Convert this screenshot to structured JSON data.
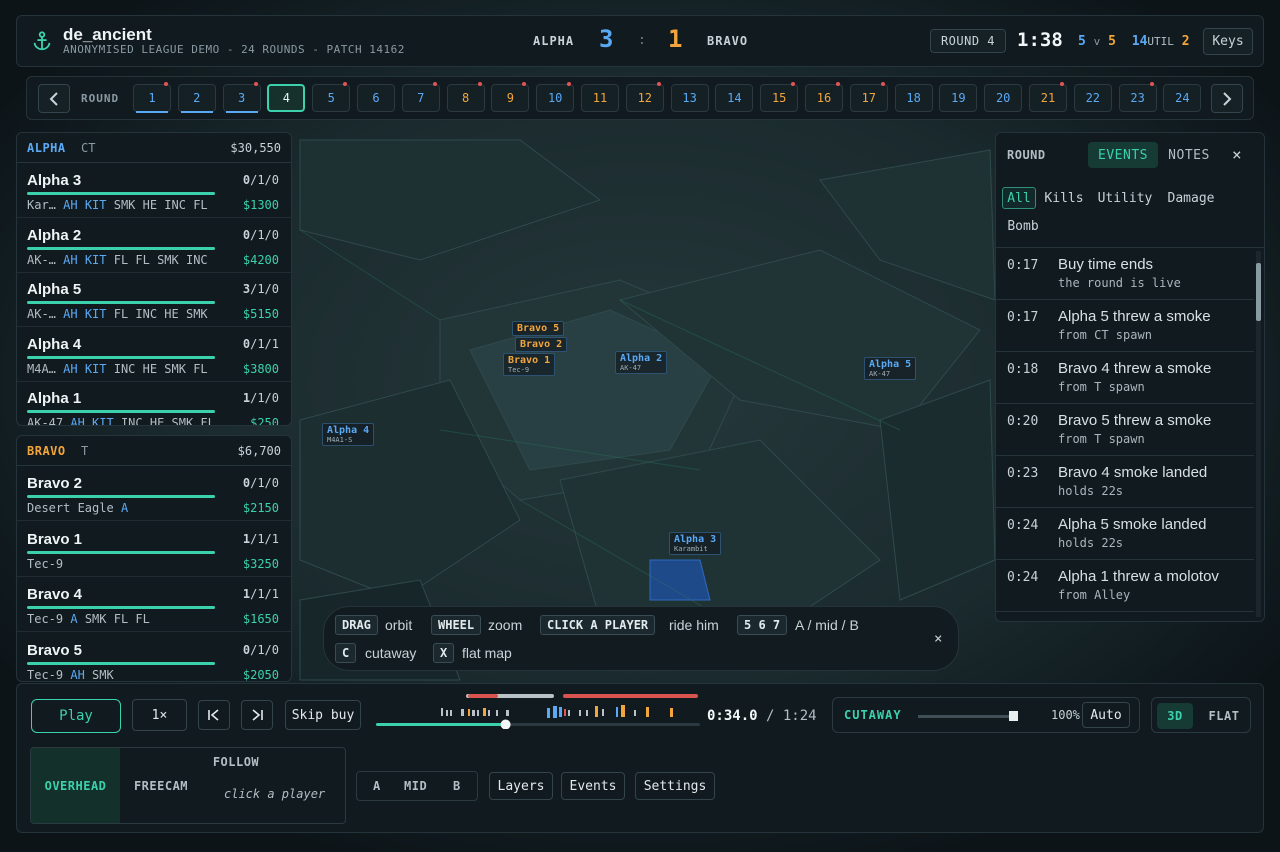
{
  "header": {
    "map_name": "de_ancient",
    "subtitle": "ANONYMISED LEAGUE DEMO - 24 ROUNDS - PATCH 14162",
    "team_a": "ALPHA",
    "score_a": "3",
    "score_sep": ":",
    "score_b": "1",
    "team_b": "BRAVO",
    "round_label": "ROUND 4",
    "clock": "1:38",
    "alive_a": "5",
    "alive_v": "v",
    "alive_b": "5",
    "util_count": "14",
    "util_label": "UTIL",
    "util_b": "2",
    "keys_label": "Keys",
    "icon": "anchor-icon"
  },
  "round_strip": {
    "label": "ROUND",
    "rounds": [
      {
        "n": "1",
        "side": "a",
        "dot": true,
        "played": true
      },
      {
        "n": "2",
        "side": "a",
        "dot": false,
        "played": true
      },
      {
        "n": "3",
        "side": "a",
        "dot": true,
        "played": true
      },
      {
        "n": "4",
        "side": "a",
        "dot": false,
        "current": true
      },
      {
        "n": "5",
        "side": "a",
        "dot": true
      },
      {
        "n": "6",
        "side": "a",
        "dot": false
      },
      {
        "n": "7",
        "side": "a",
        "dot": true
      },
      {
        "n": "8",
        "side": "b",
        "dot": true
      },
      {
        "n": "9",
        "side": "b",
        "dot": true
      },
      {
        "n": "10",
        "side": "a",
        "dot": true
      },
      {
        "n": "11",
        "side": "b",
        "dot": false
      },
      {
        "n": "12",
        "side": "b",
        "dot": true
      },
      {
        "n": "13",
        "side": "a",
        "dot": false
      },
      {
        "n": "14",
        "side": "a",
        "dot": false
      },
      {
        "n": "15",
        "side": "b",
        "dot": true
      },
      {
        "n": "16",
        "side": "b",
        "dot": true
      },
      {
        "n": "17",
        "side": "b",
        "dot": true
      },
      {
        "n": "18",
        "side": "a",
        "dot": false
      },
      {
        "n": "19",
        "side": "a",
        "dot": false
      },
      {
        "n": "20",
        "side": "a",
        "dot": false
      },
      {
        "n": "21",
        "side": "b",
        "dot": true
      },
      {
        "n": "22",
        "side": "a",
        "dot": false
      },
      {
        "n": "23",
        "side": "a",
        "dot": true
      },
      {
        "n": "24",
        "side": "a",
        "dot": false
      }
    ]
  },
  "alpha_panel": {
    "name": "ALPHA",
    "side": "CT",
    "money": "$30,550",
    "players": [
      {
        "name": "Alpha 3",
        "k": "0",
        "rest": "/1/0",
        "weapon": "Kar…",
        "kit": "AH KIT",
        "util": "SMK HE INC FL",
        "cash": "$1300"
      },
      {
        "name": "Alpha 2",
        "k": "0",
        "rest": "/1/0",
        "weapon": "AK-…",
        "kit": "AH KIT",
        "util": "FL FL SMK INC",
        "cash": "$4200"
      },
      {
        "name": "Alpha 5",
        "k": "3",
        "rest": "/1/0",
        "weapon": "AK-…",
        "kit": "AH KIT",
        "util": "FL INC HE SMK",
        "cash": "$5150"
      },
      {
        "name": "Alpha 4",
        "k": "0",
        "rest": "/1/1",
        "weapon": "M4A…",
        "kit": "AH KIT",
        "util": "INC HE SMK FL",
        "cash": "$3800"
      },
      {
        "name": "Alpha 1",
        "k": "1",
        "rest": "/1/0",
        "weapon": "AK-47",
        "kit": "AH KIT",
        "util": "INC HE SMK FL",
        "cash": "$250"
      }
    ]
  },
  "bravo_panel": {
    "name": "BRAVO",
    "side": "T",
    "money": "$6,700",
    "players": [
      {
        "name": "Bravo 2",
        "k": "0",
        "rest": "/1/0",
        "weapon": "Desert Eagle",
        "kit": "A",
        "util": "",
        "cash": "$2150"
      },
      {
        "name": "Bravo 1",
        "k": "1",
        "rest": "/1/1",
        "weapon": "Tec-9",
        "kit": "",
        "util": "",
        "cash": "$3250"
      },
      {
        "name": "Bravo 4",
        "k": "1",
        "rest": "/1/1",
        "weapon": "Tec-9",
        "kit": "A",
        "util": "SMK FL FL",
        "cash": "$1650"
      },
      {
        "name": "Bravo 5",
        "k": "0",
        "rest": "/1/0",
        "weapon": "Tec-9",
        "kit": "AH",
        "util": "SMK",
        "cash": "$2050"
      }
    ]
  },
  "events_panel": {
    "round_label": "ROUND",
    "tabs": [
      "EVENTS",
      "NOTES"
    ],
    "filters": [
      "All",
      "Kills",
      "Utility",
      "Damage",
      "Bomb"
    ],
    "events": [
      {
        "time": "0:17",
        "title": "Buy time ends",
        "detail": "the round is live"
      },
      {
        "time": "0:17",
        "title": "Alpha 5 threw a smoke",
        "detail": "from CT spawn"
      },
      {
        "time": "0:18",
        "title": "Bravo 4 threw a smoke",
        "detail": "from T spawn"
      },
      {
        "time": "0:20",
        "title": "Bravo 5 threw a smoke",
        "detail": "from T spawn"
      },
      {
        "time": "0:23",
        "title": "Bravo 4 smoke landed",
        "detail": "holds 22s"
      },
      {
        "time": "0:24",
        "title": "Alpha 5 smoke landed",
        "detail": "holds 22s"
      },
      {
        "time": "0:24",
        "title": "Alpha 1 threw a molotov",
        "detail": "from Alley"
      }
    ]
  },
  "hints": {
    "drag_key": "DRAG",
    "drag_text": "orbit",
    "wheel_key": "WHEEL",
    "wheel_text": "zoom",
    "click_key": "CLICK A PLAYER",
    "click_text": "ride him",
    "sites_key": "5 6 7",
    "sites_text": "A / mid / B",
    "c_key": "C",
    "c_text": "cutaway",
    "x_key": "X",
    "x_text": "flat map"
  },
  "playback": {
    "play_label": "Play",
    "speed_label": "1×",
    "skip_label": "Skip buy",
    "current_time": "0:34.0",
    "time_sep": " / ",
    "total_time": "1:24",
    "progress": 0.4
  },
  "cutaway": {
    "label": "CUTAWAY",
    "percent": "100%",
    "value": 1.0,
    "auto_label": "Auto"
  },
  "view_toggle": {
    "modes": [
      "3D",
      "FLAT"
    ],
    "active": "3D"
  },
  "camera": {
    "overhead": "OVERHEAD",
    "freecam": "FREECAM",
    "follow": "FOLLOW",
    "follow_hint": "click a player"
  },
  "sites": [
    "A",
    "MID",
    "B"
  ],
  "menu_buttons": {
    "layers": "Layers",
    "events": "Events",
    "settings": "Settings"
  },
  "map_players": [
    {
      "name": "Bravo 5",
      "team": "b",
      "weapon": ""
    },
    {
      "name": "Bravo 2",
      "team": "b",
      "weapon": ""
    },
    {
      "name": "Bravo 1",
      "team": "b",
      "weapon": "Tec-9"
    },
    {
      "name": "Alpha 2",
      "team": "a",
      "weapon": "AK-47"
    },
    {
      "name": "Alpha 5",
      "team": "a",
      "weapon": "AK-47"
    },
    {
      "name": "Alpha 4",
      "team": "a",
      "weapon": "M4A1-S"
    },
    {
      "name": "Alpha 3",
      "team": "a",
      "weapon": "Karambit"
    }
  ],
  "colors": {
    "accent": "#3bd1ad",
    "team_a": "#5aa9f5",
    "team_b": "#f2a53c",
    "alert": "#e25555"
  }
}
